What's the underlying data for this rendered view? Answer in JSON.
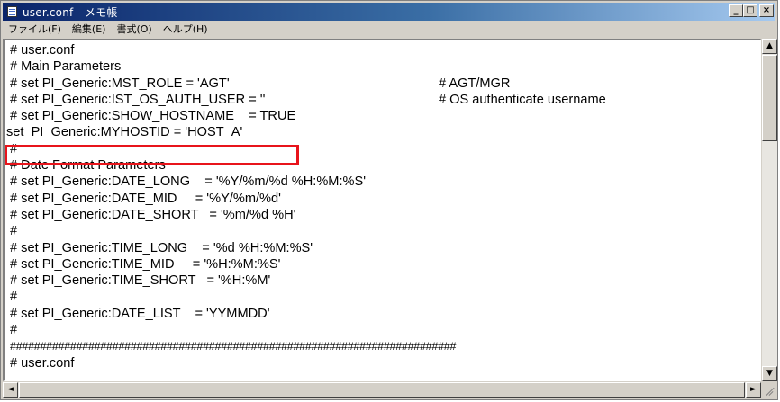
{
  "window": {
    "title": "user.conf - メモ帳",
    "buttons": {
      "minimize": "_",
      "maximize": "□",
      "close": "×"
    }
  },
  "menu": [
    {
      "label": "ファイル(F)"
    },
    {
      "label": "編集(E)"
    },
    {
      "label": "書式(O)"
    },
    {
      "label": "ヘルプ(H)"
    }
  ],
  "editor": {
    "lines": [
      {
        "text": "# user.conf",
        "comment": ""
      },
      {
        "text": "# Main Parameters",
        "comment": ""
      },
      {
        "text": "# set PI_Generic:MST_ROLE = 'AGT'",
        "comment": "# AGT/MGR"
      },
      {
        "text": "# set PI_Generic:IST_OS_AUTH_USER = ''",
        "comment": "# OS authenticate username"
      },
      {
        "text": "# set PI_Generic:SHOW_HOSTNAME    = TRUE",
        "comment": ""
      },
      {
        "text": "set  PI_Generic:MYHOSTID = 'HOST_A'",
        "comment": ""
      },
      {
        "text": "#",
        "comment": ""
      },
      {
        "text": "# Date Format Parameters",
        "comment": ""
      },
      {
        "text": "# set PI_Generic:DATE_LONG    = '%Y/%m/%d %H:%M:%S'",
        "comment": ""
      },
      {
        "text": "# set PI_Generic:DATE_MID     = '%Y/%m/%d'",
        "comment": ""
      },
      {
        "text": "# set PI_Generic:DATE_SHORT   = '%m/%d %H'",
        "comment": ""
      },
      {
        "text": "#",
        "comment": ""
      },
      {
        "text": "# set PI_Generic:TIME_LONG    = '%d %H:%M:%S'",
        "comment": ""
      },
      {
        "text": "# set PI_Generic:TIME_MID     = '%H:%M:%S'",
        "comment": ""
      },
      {
        "text": "# set PI_Generic:TIME_SHORT   = '%H:%M'",
        "comment": ""
      },
      {
        "text": "#",
        "comment": ""
      },
      {
        "text": "# set PI_Generic:DATE_LIST    = 'YYMMDD'",
        "comment": ""
      },
      {
        "text": "#",
        "comment": ""
      },
      {
        "text": "##########################################################################",
        "comment": ""
      },
      {
        "text": "# user.conf",
        "comment": ""
      }
    ]
  },
  "colors": {
    "highlight": "#e8141b",
    "titlebar_start": "#0a246a",
    "titlebar_end": "#a6caf0"
  }
}
